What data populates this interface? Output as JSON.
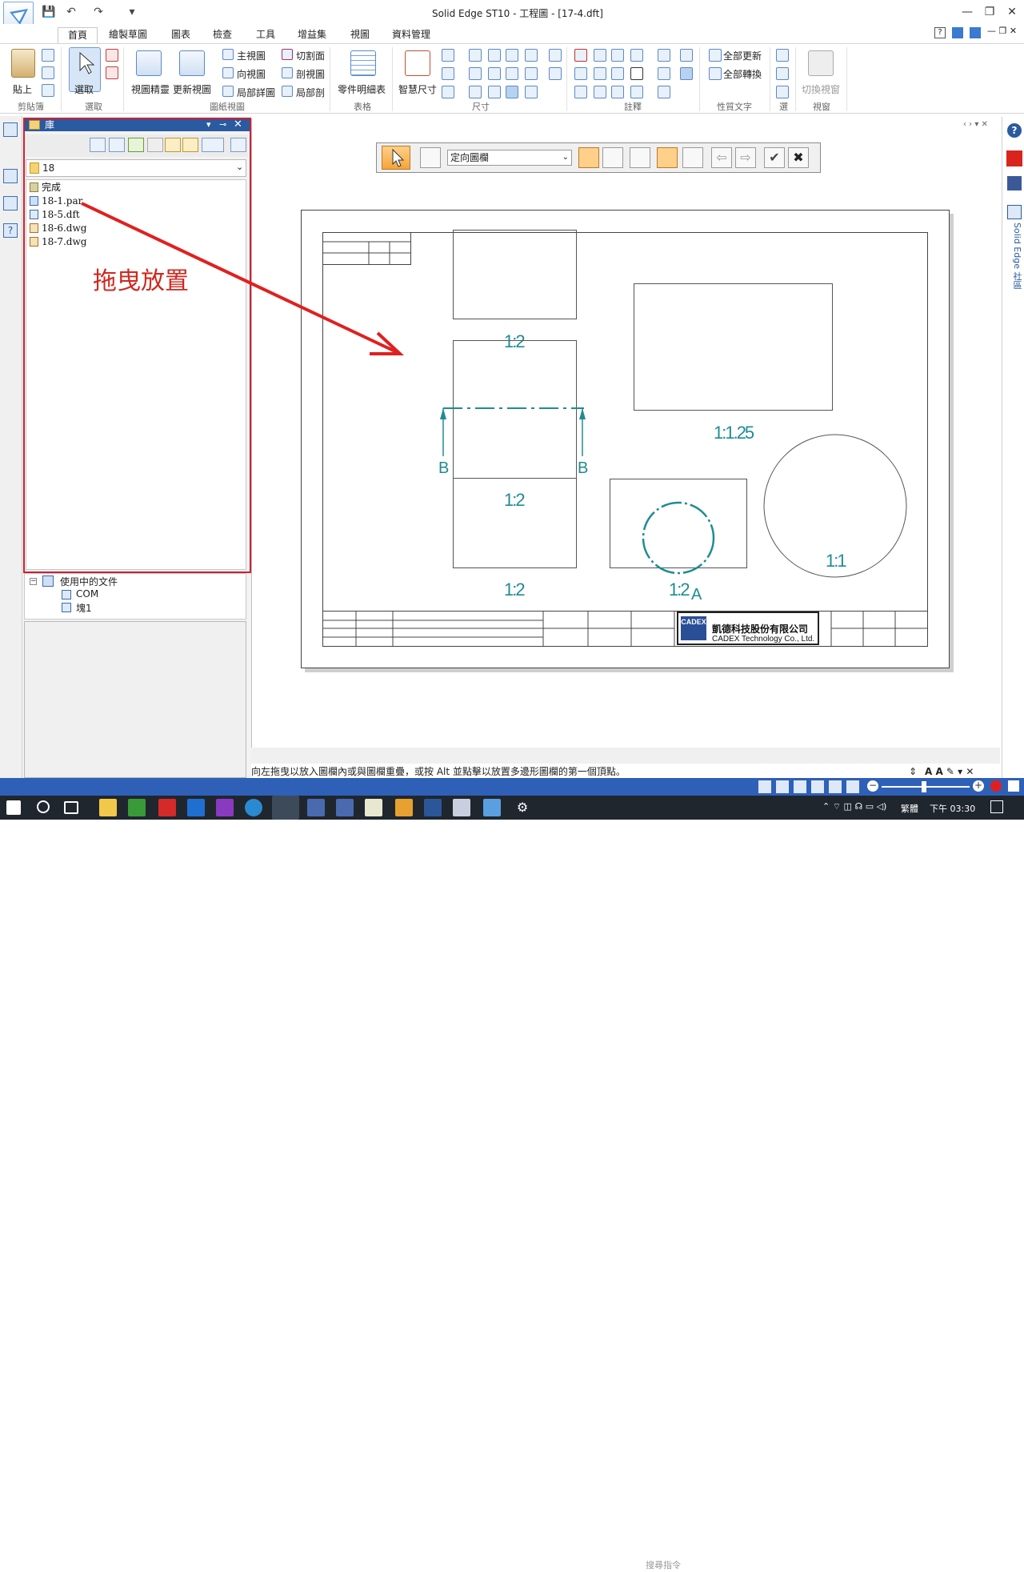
{
  "window": {
    "title": "Solid Edge ST10 - 工程圖 - [17-4.dft]"
  },
  "ribbon": {
    "tabs": [
      "首頁",
      "繪製草圖",
      "圖表",
      "檢查",
      "工具",
      "增益集",
      "視圖",
      "資料管理"
    ],
    "groups": {
      "clipboard": {
        "label": "剪貼簿",
        "paste": "貼上"
      },
      "select": {
        "label": "選取",
        "select": "選取"
      },
      "drawing_views": {
        "label": "圖紙視圖",
        "view_wizard": "視圖精靈",
        "update_views": "更新視圖",
        "main_view": "主視圖",
        "section": "切割面",
        "projected": "向視圖",
        "section_view": "剖視圖",
        "detail": "局部詳圖",
        "broken": "局部剖"
      },
      "tables": {
        "label": "表格",
        "parts_list": "零件明細表"
      },
      "dimension": {
        "label": "尺寸",
        "smart_dim": "智慧尺寸"
      },
      "annotation": {
        "label": "註釋"
      },
      "property_text": {
        "label": "性質文字",
        "update_all": "全部更新",
        "convert_all": "全部轉換"
      },
      "misc": {
        "label": "選"
      },
      "window": {
        "label": "視窗",
        "switch_window": "切換視窗"
      }
    }
  },
  "library": {
    "title": "庫",
    "folder": "18",
    "items": [
      {
        "name": "完成",
        "type": "folder"
      },
      {
        "name": "18-1.par",
        "type": "par"
      },
      {
        "name": "18-5.dft",
        "type": "dft"
      },
      {
        "name": "18-6.dwg",
        "type": "dwg"
      },
      {
        "name": "18-7.dwg",
        "type": "dwg"
      }
    ],
    "drag_hint": "拖曳放置"
  },
  "tree": {
    "root": "使用中的文件",
    "children": [
      "COM",
      "塊1"
    ]
  },
  "commandbar": {
    "dropdown": "定向圖欄"
  },
  "drawing": {
    "scales": [
      "1:2",
      "1:2",
      "1:2",
      "1:2",
      "1:1.25",
      "1:2",
      "1:1"
    ],
    "section_labels": [
      "B",
      "B",
      "A"
    ],
    "company_cn": "凱德科技股份有限公司",
    "company_en": "CADEX Technology Co., Ltd.",
    "logo_text": "CADEX"
  },
  "status": {
    "message": "向左拖曳以放入圖欄內或與圖欄重疊，或按 Alt 並點擊以放置多邊形圖欄的第一個頂點。",
    "search_placeholder": "搜尋指令"
  },
  "right_panel": {
    "community": "Solid Edge 社區"
  },
  "taskbar": {
    "ime": "繁體",
    "time": "下午 03:30"
  },
  "colors": {
    "accent": "#2a5aa0",
    "highlight": "#d02030",
    "drawing_teal": "#1f8c92"
  }
}
